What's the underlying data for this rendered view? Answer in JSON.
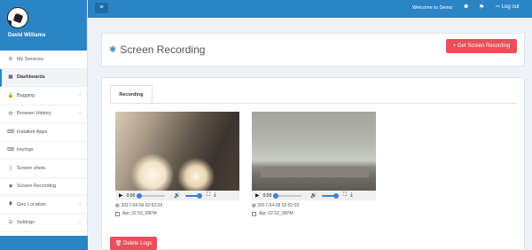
{
  "sidebar": {
    "username": "David Williams",
    "items": [
      {
        "label": "My Services",
        "icon": "gear-icon",
        "glyph": "⚙",
        "chevron": false
      },
      {
        "label": "Dashboards",
        "icon": "grid-icon",
        "glyph": "▦",
        "chevron": false,
        "active": true
      },
      {
        "label": "Bugging",
        "icon": "lock-icon",
        "glyph": "🔒",
        "chevron": true
      },
      {
        "label": "Browser History",
        "icon": "globe-icon",
        "glyph": "◍",
        "chevron": true
      },
      {
        "label": "Installed Apps",
        "icon": "keyboard-icon",
        "glyph": "⌨",
        "chevron": false
      },
      {
        "label": "keylogs",
        "icon": "keyboard-icon",
        "glyph": "⌨",
        "chevron": false
      },
      {
        "label": "Screen shots",
        "icon": "file-icon",
        "glyph": "▯",
        "chevron": false
      },
      {
        "label": "Screen Recording",
        "icon": "record-icon",
        "glyph": "◉",
        "chevron": false
      },
      {
        "label": "Geo Location",
        "icon": "map-pin-icon",
        "glyph": "⬮",
        "chevron": true
      },
      {
        "label": "Settings",
        "icon": "sliders-icon",
        "glyph": "☰",
        "chevron": true
      }
    ]
  },
  "topbar": {
    "menu_glyph": "≡",
    "welcome": "Welcome to Demo",
    "logout": "Log out"
  },
  "header": {
    "title": "Screen Recording",
    "get_button": "+ Get Screen Recording"
  },
  "tabs": {
    "recording": "Recording"
  },
  "recordings": [
    {
      "time": "0:00",
      "datetime": "2017-04-09 02:53:03",
      "name": "Apr, 02 53_05PM"
    },
    {
      "time": "0:00",
      "datetime": "2017-04-09 02:52:03",
      "name": "Apr, 02 52_05PM"
    }
  ],
  "delete_button": "🗑 Delete Logs",
  "colors": {
    "primary": "#2b84c6",
    "danger": "#e8515a"
  }
}
